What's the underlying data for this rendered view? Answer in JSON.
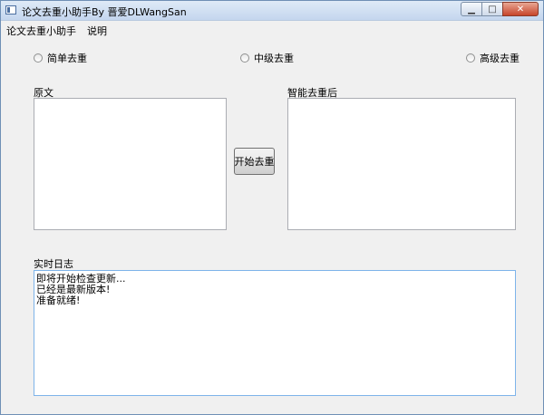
{
  "window": {
    "title": "论文去重小助手By 晋爱DLWangSan",
    "minimize_glyph": "▁",
    "maximize_glyph": "□",
    "close_glyph": "✕"
  },
  "menu": [
    "论文去重小助手",
    "说明"
  ],
  "options": [
    {
      "label": "简单去重",
      "selected": false
    },
    {
      "label": "中级去重",
      "selected": false
    },
    {
      "label": "高级去重",
      "selected": false
    }
  ],
  "original": {
    "label": "原文",
    "value": ""
  },
  "result": {
    "label": "智能去重后",
    "value": ""
  },
  "start_button": "开始去重",
  "log": {
    "label": "实时日志",
    "lines": [
      "即将开始检查更新...",
      "已经是最新版本!",
      "准备就绪!"
    ]
  }
}
